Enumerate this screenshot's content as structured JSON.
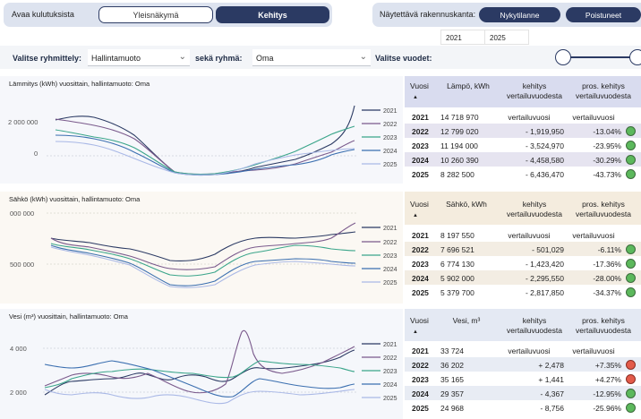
{
  "topbar": {
    "open_label": "Avaa kulutuksista",
    "tab_overview": "Yleisnäkymä",
    "tab_trend": "Kehitys",
    "building_label": "Näytettävä rakennuskanta:",
    "btn_current": "Nykytilanne",
    "btn_removed": "Poistuneet"
  },
  "years_range": {
    "from": "2021",
    "to": "2025"
  },
  "filters": {
    "group_by_label": "Valitse ryhmittely:",
    "group_by_value": "Hallintamuoto",
    "group_label": "sekä ryhmä:",
    "group_value": "Oma",
    "years_label": "Valitse vuodet:"
  },
  "colors": {
    "2021": "#2b3a63",
    "2022": "#7a5a8c",
    "2023": "#3aa58a",
    "2024": "#3b6fb0",
    "2025": "#a9b8e6",
    "ok": "#5cb85c",
    "bad": "#e35b4a"
  },
  "charts": [
    {
      "title": "Lämmitys (kWh) vuosittain, hallintamuoto: Oma",
      "y_ticks": [
        "2 000 000",
        "0"
      ],
      "legend": [
        "2021",
        "2022",
        "2023",
        "2024",
        "2025"
      ]
    },
    {
      "title": "Sähkö (kWh) vuosittain, hallintamuoto: Oma",
      "y_ticks": [
        "000 000",
        "500 000"
      ],
      "legend": [
        "2021",
        "2022",
        "2023",
        "2024",
        "2025"
      ]
    },
    {
      "title": "Vesi (m³) vuosittain, hallintamuoto: Oma",
      "y_ticks": [
        "4 000",
        "2 000"
      ],
      "legend": [
        "2021",
        "2022",
        "2023",
        "2024",
        "2025"
      ]
    }
  ],
  "tables": [
    {
      "h_year": "Vuosi",
      "h_val": "Lämpö, kWh",
      "h_dev": "kehitys vertailuvuodesta",
      "h_pct": "pros. kehitys vertailuvuodesta",
      "rows": [
        {
          "year": "2021",
          "val": "14 718 970",
          "dev": "vertailuvuosi",
          "pct": "vertailuvuosi",
          "status": ""
        },
        {
          "year": "2022",
          "val": "12 799 020",
          "dev": "- 1,919,950",
          "pct": "-13.04%",
          "status": "ok"
        },
        {
          "year": "2023",
          "val": "11 194 000",
          "dev": "- 3,524,970",
          "pct": "-23.95%",
          "status": "ok"
        },
        {
          "year": "2024",
          "val": "10 260 390",
          "dev": "- 4,458,580",
          "pct": "-30.29%",
          "status": "ok"
        },
        {
          "year": "2025",
          "val": "8 282 500",
          "dev": "- 6,436,470",
          "pct": "-43.73%",
          "status": "ok"
        }
      ]
    },
    {
      "h_year": "Vuosi",
      "h_val": "Sähkö, kWh",
      "h_dev": "kehitys vertailuvuodesta",
      "h_pct": "pros. kehitys vertailuvuodesta",
      "rows": [
        {
          "year": "2021",
          "val": "8 197 550",
          "dev": "vertailuvuosi",
          "pct": "vertailuvuosi",
          "status": ""
        },
        {
          "year": "2022",
          "val": "7 696 521",
          "dev": "- 501,029",
          "pct": "-6.11%",
          "status": "ok"
        },
        {
          "year": "2023",
          "val": "6 774 130",
          "dev": "- 1,423,420",
          "pct": "-17.36%",
          "status": "ok"
        },
        {
          "year": "2024",
          "val": "5 902 000",
          "dev": "- 2,295,550",
          "pct": "-28.00%",
          "status": "ok"
        },
        {
          "year": "2025",
          "val": "5 379 700",
          "dev": "- 2,817,850",
          "pct": "-34.37%",
          "status": "ok"
        }
      ]
    },
    {
      "h_year": "Vuosi",
      "h_val": "Vesi, m³",
      "h_dev": "kehitys vertailuvuodesta",
      "h_pct": "pros. kehitys vertailuvuodesta",
      "rows": [
        {
          "year": "2021",
          "val": "33 724",
          "dev": "vertailuvuosi",
          "pct": "vertailuvuosi",
          "status": ""
        },
        {
          "year": "2022",
          "val": "36 202",
          "dev": "+ 2,478",
          "pct": "+7.35%",
          "status": "bad"
        },
        {
          "year": "2023",
          "val": "35 165",
          "dev": "+ 1,441",
          "pct": "+4.27%",
          "status": "bad"
        },
        {
          "year": "2024",
          "val": "29 357",
          "dev": "- 4,367",
          "pct": "-12.95%",
          "status": "ok"
        },
        {
          "year": "2025",
          "val": "24 968",
          "dev": "- 8,756",
          "pct": "-25.96%",
          "status": "ok"
        }
      ]
    }
  ]
}
